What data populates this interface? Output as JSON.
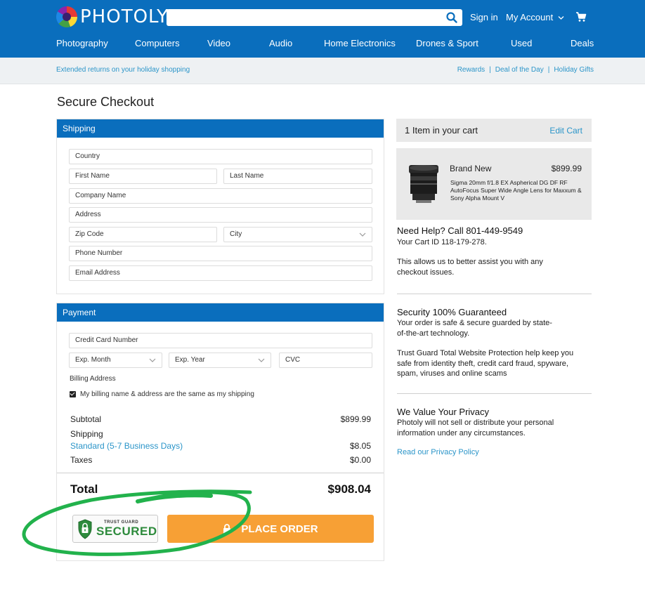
{
  "header": {
    "brand": "PHOTOLY",
    "sign_in": "Sign in",
    "my_account": "My Account",
    "search_icon": "search-icon",
    "cart_icon": "cart-icon"
  },
  "nav": {
    "items": [
      "Photography",
      "Computers",
      "Video",
      "Audio",
      "Home Electronics",
      "Drones & Sport",
      "Used",
      "Deals"
    ]
  },
  "promo": {
    "left": "Extended returns on your holiday shopping",
    "links": [
      "Rewards",
      "Deal of the Day",
      "Holiday Gifts"
    ],
    "separator": "|"
  },
  "page_title": "Secure Checkout",
  "shipping": {
    "heading": "Shipping",
    "country": "Country",
    "first_name": "First Name",
    "last_name": "Last Name",
    "company": "Company Name",
    "address": "Address",
    "zip": "Zip Code",
    "city": "City",
    "phone": "Phone Number",
    "email": "Email Address"
  },
  "payment": {
    "heading": "Payment",
    "card_number": "Credit Card Number",
    "exp_month": "Exp. Month",
    "exp_year": "Exp. Year",
    "cvc": "CVC",
    "billing_label": "Billing Address",
    "same_as_shipping": "My billing name & address are the same as my shipping",
    "same_as_shipping_checked": true
  },
  "summary": {
    "subtotal_label": "Subtotal",
    "subtotal_value": "$899.99",
    "shipping_label": "Shipping",
    "shipping_method": "Standard (5-7 Business Days)",
    "shipping_value": "$8.05",
    "taxes_label": "Taxes",
    "taxes_value": "$0.00",
    "total_label": "Total",
    "total_value": "$908.04"
  },
  "trust_badge": {
    "small": "TRUST GUARD",
    "big": "SECURED",
    "shield_icon": "shield-lock-icon"
  },
  "place_order": {
    "label": "PLACE ORDER",
    "icon": "lock-icon"
  },
  "cart": {
    "count_text": "1 Item in your cart",
    "edit": "Edit Cart",
    "item": {
      "condition": "Brand New",
      "price": "$899.99",
      "description": "Sigma 20mm f/1.8 EX Aspherical DG DF RF AutoFocus Super Wide Angle Lens for Maxxum & Sony Alpha Mount V",
      "image_icon": "camera-lens-image"
    }
  },
  "help": {
    "heading": "Need Help? Call 801-449-9549",
    "cart_id": "Your Cart ID 118-179-278.",
    "text": "This allows us to better assist you with any checkout issues."
  },
  "security": {
    "heading": "Security 100% Guaranteed",
    "text1": "Your order is safe & secure guarded by state-of-the-art technology.",
    "text2": "Trust Guard Total Website Protection help keep you safe from identity theft, credit card fraud, spyware, spam, viruses and online scams"
  },
  "privacy": {
    "heading": "We Value Your Privacy",
    "text": "Photoly will not sell or distribute your personal information under any circumstances.",
    "link": "Read our Privacy Policy"
  },
  "colors": {
    "brand_blue": "#0a6ebd",
    "link_blue": "#2b95c9",
    "order_orange": "#f7a035",
    "annotation_green": "#22b24c"
  }
}
